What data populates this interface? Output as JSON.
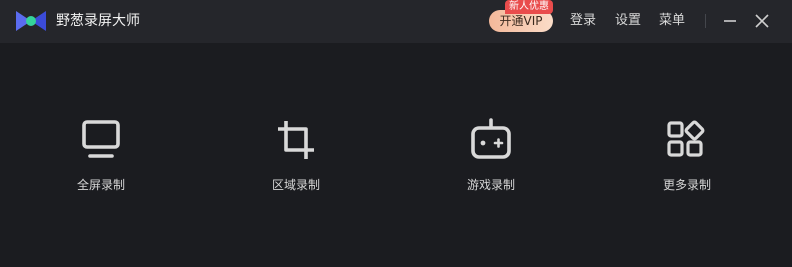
{
  "app": {
    "title": "野葱录屏大师"
  },
  "header": {
    "vip_label": "开通VIP",
    "vip_badge": "新人优惠",
    "login": "登录",
    "settings": "设置",
    "menu": "菜单"
  },
  "modes": [
    {
      "label": "全屏录制",
      "icon": "monitor-icon"
    },
    {
      "label": "区域录制",
      "icon": "crop-icon"
    },
    {
      "label": "游戏录制",
      "icon": "gamepad-icon"
    },
    {
      "label": "更多录制",
      "icon": "apps-grid-icon"
    }
  ],
  "colors": {
    "background": "#1b1c20",
    "titlebar": "#25262b",
    "vip_gradient_start": "#f3b89a",
    "badge": "#e94c4c",
    "logo_blue": "#5b6cf0",
    "logo_green": "#35d39a"
  }
}
